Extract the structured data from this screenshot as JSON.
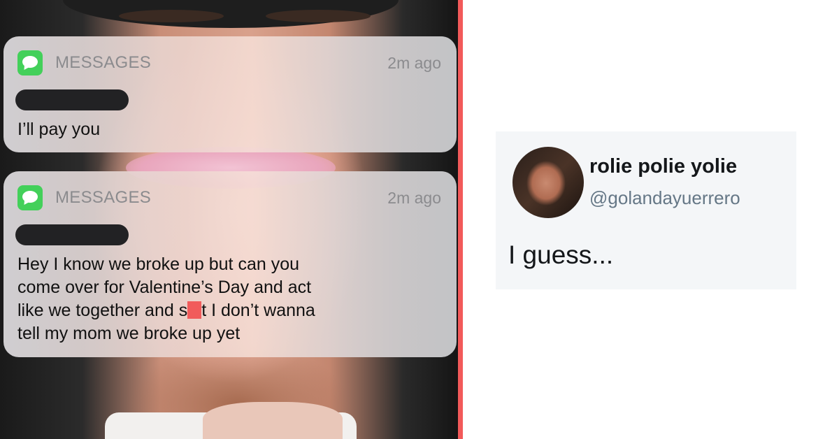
{
  "notifications": [
    {
      "app_name": "MESSAGES",
      "time": "2m ago",
      "body": "I’ll pay you"
    },
    {
      "app_name": "MESSAGES",
      "time": "2m ago",
      "lines": [
        "Hey I know we broke up but can you",
        "come over for Valentine’s Day and act"
      ],
      "line3_before": "like we together and s",
      "line3_after": "t I don’t wanna",
      "line4": "tell my mom we broke up yet"
    }
  ],
  "tweet": {
    "display_name": "rolie polie yolie",
    "handle": "@golandayuerrero",
    "text": "I guess..."
  },
  "colors": {
    "divider": "#f25a5a",
    "censor": "#f15b5b",
    "messages_icon": "#43d05a"
  },
  "icons": [
    "messages-app-icon",
    "avatar-photo"
  ]
}
